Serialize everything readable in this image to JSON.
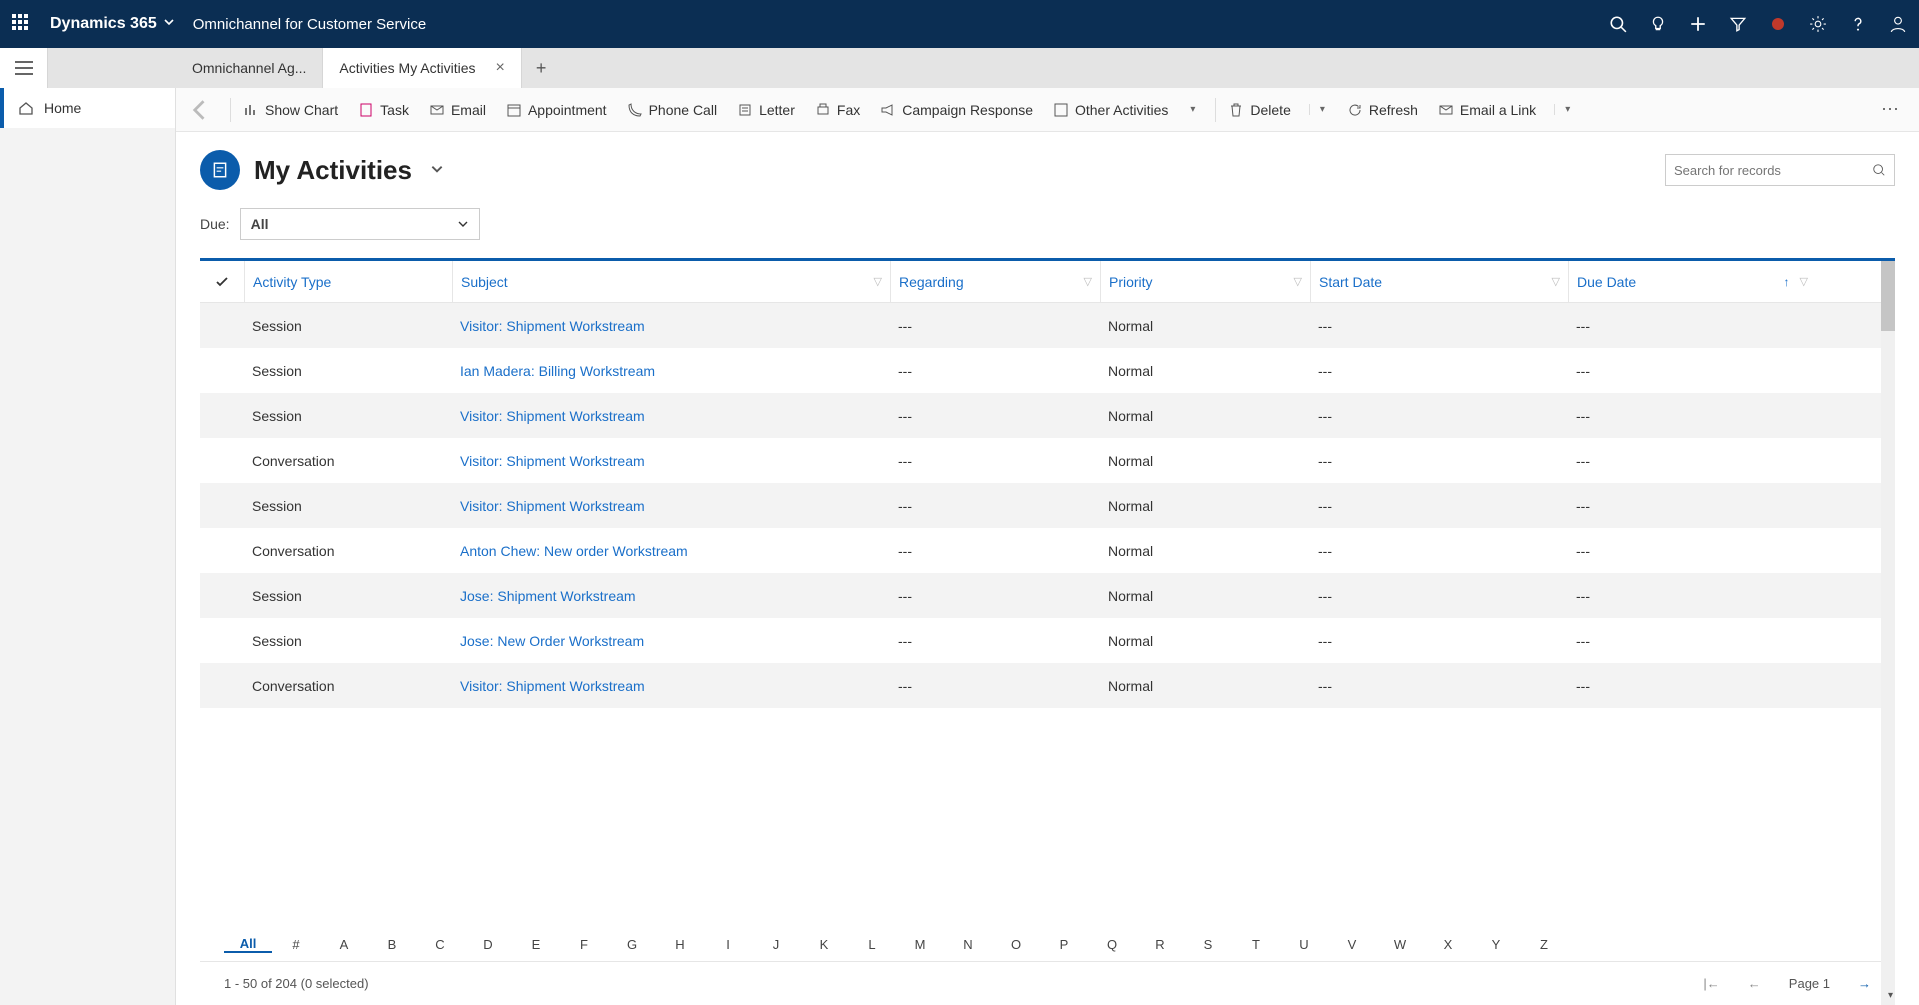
{
  "header": {
    "brand": "Dynamics 365",
    "app_name": "Omnichannel for Customer Service"
  },
  "tabs": [
    {
      "label": "Omnichannel Ag...",
      "active": false,
      "closable": false
    },
    {
      "label": "Activities My Activities",
      "active": true,
      "closable": true
    }
  ],
  "leftnav": {
    "home": "Home"
  },
  "cmdbar": {
    "show_chart": "Show Chart",
    "task": "Task",
    "email": "Email",
    "appointment": "Appointment",
    "phone": "Phone Call",
    "letter": "Letter",
    "fax": "Fax",
    "campaign": "Campaign Response",
    "other": "Other Activities",
    "delete": "Delete",
    "refresh": "Refresh",
    "email_link": "Email a Link"
  },
  "page": {
    "title": "My Activities",
    "search_placeholder": "Search for records"
  },
  "filter": {
    "label": "Due:",
    "value": "All"
  },
  "columns": {
    "type": "Activity Type",
    "subject": "Subject",
    "regarding": "Regarding",
    "priority": "Priority",
    "start": "Start Date",
    "due": "Due Date"
  },
  "rows": [
    {
      "type": "Session",
      "subject": "Visitor: Shipment Workstream",
      "regarding": "---",
      "priority": "Normal",
      "start": "---",
      "due": "---"
    },
    {
      "type": "Session",
      "subject": "Ian Madera: Billing Workstream",
      "regarding": "---",
      "priority": "Normal",
      "start": "---",
      "due": "---"
    },
    {
      "type": "Session",
      "subject": "Visitor: Shipment Workstream",
      "regarding": "---",
      "priority": "Normal",
      "start": "---",
      "due": "---"
    },
    {
      "type": "Conversation",
      "subject": "Visitor: Shipment Workstream",
      "regarding": "---",
      "priority": "Normal",
      "start": "---",
      "due": "---"
    },
    {
      "type": "Session",
      "subject": "Visitor: Shipment Workstream",
      "regarding": "---",
      "priority": "Normal",
      "start": "---",
      "due": "---"
    },
    {
      "type": "Conversation",
      "subject": "Anton Chew: New order Workstream",
      "regarding": "---",
      "priority": "Normal",
      "start": "---",
      "due": "---"
    },
    {
      "type": "Session",
      "subject": "Jose: Shipment Workstream",
      "regarding": "---",
      "priority": "Normal",
      "start": "---",
      "due": "---"
    },
    {
      "type": "Session",
      "subject": "Jose: New Order Workstream",
      "regarding": "---",
      "priority": "Normal",
      "start": "---",
      "due": "---"
    },
    {
      "type": "Conversation",
      "subject": "Visitor: Shipment Workstream",
      "regarding": "---",
      "priority": "Normal",
      "start": "---",
      "due": "---"
    }
  ],
  "alpha": [
    "All",
    "#",
    "A",
    "B",
    "C",
    "D",
    "E",
    "F",
    "G",
    "H",
    "I",
    "J",
    "K",
    "L",
    "M",
    "N",
    "O",
    "P",
    "Q",
    "R",
    "S",
    "T",
    "U",
    "V",
    "W",
    "X",
    "Y",
    "Z"
  ],
  "footer": {
    "status": "1 - 50 of 204 (0 selected)",
    "page_label": "Page 1"
  }
}
